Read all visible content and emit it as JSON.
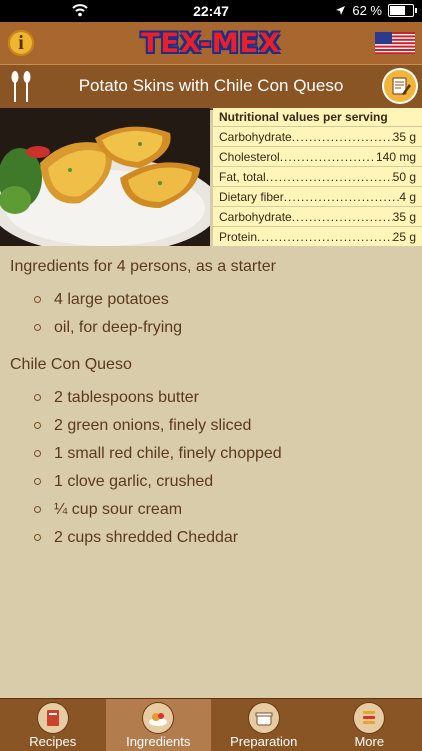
{
  "status_bar": {
    "time": "22:47",
    "battery": "62 %",
    "battery_level": 0.62,
    "icons": [
      "wifi-icon",
      "location-icon",
      "battery-icon"
    ]
  },
  "header": {
    "logo": "TEX-MEX",
    "info_icon": "info-icon",
    "flag_icon": "us-flag-icon"
  },
  "title_bar": {
    "title": "Potato Skins with Chile Con Queso",
    "left_icon": "utensils-icon",
    "right_icon": "notes-icon"
  },
  "nutrition": {
    "heading": "Nutritional values per serving",
    "rows": [
      {
        "label": "Carbohydrate",
        "value": "35 g"
      },
      {
        "label": "Cholesterol",
        "value": "140 mg"
      },
      {
        "label": "Fat, total",
        "value": "50 g"
      },
      {
        "label": "Dietary fiber",
        "value": "4 g"
      },
      {
        "label": "Carbohydrate",
        "value": "35 g"
      },
      {
        "label": "Protein",
        "value": "25 g"
      }
    ]
  },
  "ingredients": {
    "sections": [
      {
        "title": "Ingredients for 4 persons, as a starter",
        "items": [
          "4 large potatoes",
          "oil, for deep-frying"
        ]
      },
      {
        "title": "Chile Con Queso",
        "items": [
          "2 tablespoons butter",
          "2 green onions, finely sliced",
          "1 small red chile, finely chopped",
          "1 clove garlic, crushed",
          "¼ cup sour cream",
          "2 cups shredded Cheddar"
        ]
      }
    ]
  },
  "tabs": [
    {
      "label": "Recipes",
      "icon": "recipes-icon"
    },
    {
      "label": "Ingredients",
      "icon": "ingredients-icon",
      "active": true
    },
    {
      "label": "Preparation",
      "icon": "preparation-icon"
    },
    {
      "label": "More",
      "icon": "more-icon"
    }
  ],
  "colors": {
    "background": "#d9ccaa",
    "topbar": "#a8672f",
    "titlebar": "#8a5525",
    "nutrition_bg": "#fff5b8",
    "text": "#5b3a1c"
  }
}
